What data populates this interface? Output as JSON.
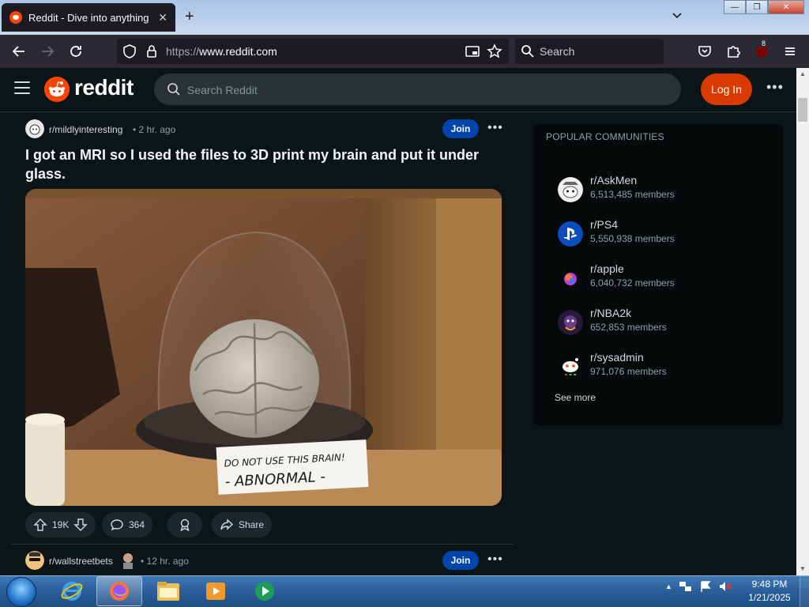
{
  "browser": {
    "tab_title": "Reddit - Dive into anything",
    "url_protocol": "https://",
    "url_host": "www.reddit.com",
    "search_placeholder": "Search",
    "extension_badge": "8"
  },
  "header": {
    "logo_text": "reddit",
    "search_placeholder": "Search Reddit",
    "login_label": "Log In",
    "more_label": "•••"
  },
  "posts": [
    {
      "subreddit": "r/mildlyinteresting",
      "time": "• 2 hr. ago",
      "join_label": "Join",
      "menu_label": "•••",
      "title": "I got an MRI so I used the files to 3D print my brain and put it under glass.",
      "image_label_line1": "DO NOT USE THIS BRAIN!",
      "image_label_line2": "- ABNORMAL -",
      "upvotes": "19K",
      "comments": "364",
      "share_label": "Share"
    },
    {
      "subreddit": "r/wallstreetbets",
      "time": "• 12 hr. ago",
      "join_label": "Join",
      "menu_label": "•••"
    }
  ],
  "sidebar": {
    "title": "POPULAR COMMUNITIES",
    "communities": [
      {
        "name": "r/AskMen",
        "members": "6,513,485 members",
        "icon": "askmen-icon"
      },
      {
        "name": "r/PS4",
        "members": "5,550,938 members",
        "icon": "playstation-icon"
      },
      {
        "name": "r/apple",
        "members": "6,040,732 members",
        "icon": "apple-icon"
      },
      {
        "name": "r/NBA2k",
        "members": "652,853 members",
        "icon": "nba2k-icon"
      },
      {
        "name": "r/sysadmin",
        "members": "971,076 members",
        "icon": "sysadmin-icon"
      }
    ],
    "see_more": "See more"
  },
  "taskbar": {
    "time": "9:48 PM",
    "date": "1/21/2025"
  },
  "colors": {
    "reddit_orange": "#ff4500",
    "login_button": "#d93a00",
    "join_button": "#0045ac",
    "background": "#0b1416"
  }
}
